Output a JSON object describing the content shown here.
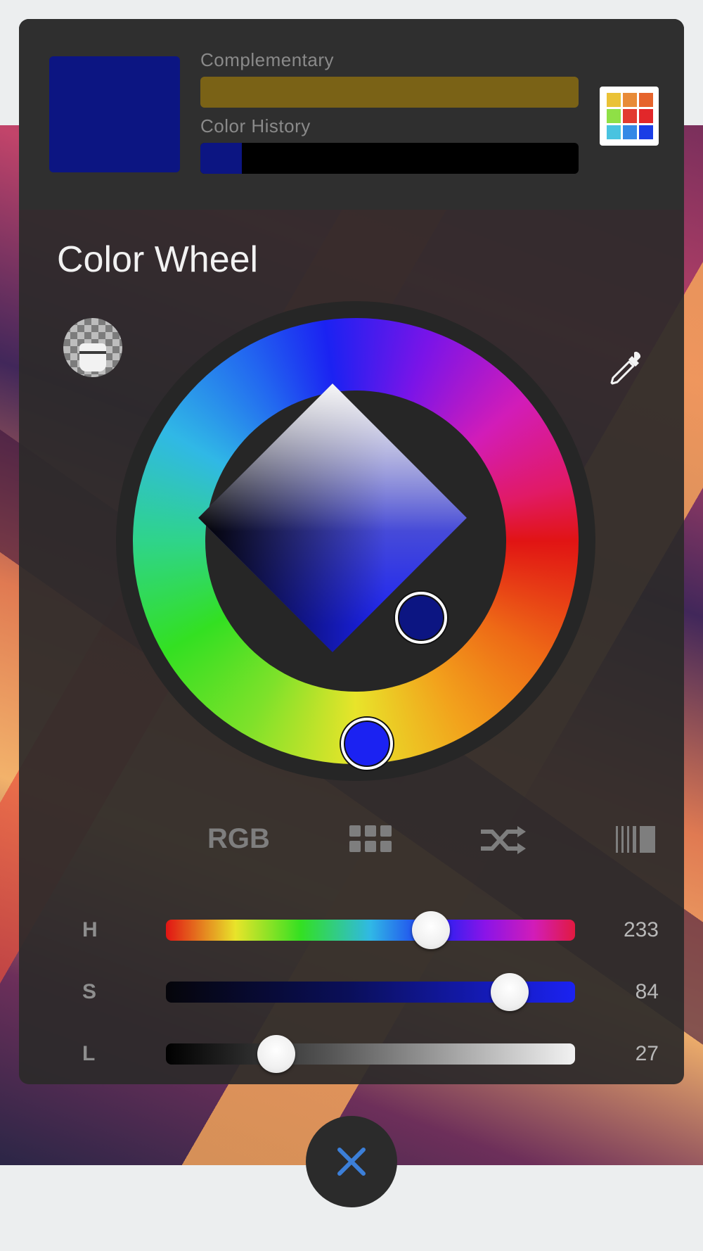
{
  "colors": {
    "current": "#0c1582",
    "previous": "#0c1582",
    "complementary": "#7a6216",
    "history": [
      "#0c1582"
    ],
    "hue_accent": "#1b22f2",
    "close_icon": "#3c7fd8",
    "palette_grid": [
      "#eac236",
      "#e88b38",
      "#e6642c",
      "#8fe046",
      "#e23a30",
      "#e2272a",
      "#49c3e0",
      "#3488e6",
      "#1a3de6"
    ]
  },
  "header": {
    "complementary_label": "Complementary",
    "history_label": "Color History"
  },
  "panel": {
    "title": "Color Wheel"
  },
  "icons": {
    "palettes": "palettes-grid-icon",
    "transparency": "transparency-icon",
    "eyedropper": "eyedropper-icon",
    "close": "close-icon"
  },
  "mode_tabs": {
    "rgb_label": "RGB",
    "grid": "grid-icon",
    "shuffle": "shuffle-icon",
    "bars": "bars-icon"
  },
  "sliders": {
    "h": {
      "label": "H",
      "value": "233",
      "fraction": 0.647
    },
    "s": {
      "label": "S",
      "value": "84",
      "fraction": 0.84
    },
    "l": {
      "label": "L",
      "value": "27",
      "fraction": 0.27
    }
  }
}
